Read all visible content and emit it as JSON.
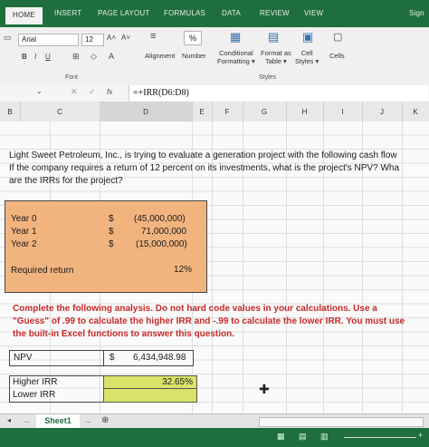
{
  "ribbon": {
    "tabs": [
      "HOME",
      "INSERT",
      "PAGE LAYOUT",
      "FORMULAS",
      "DATA",
      "REVIEW",
      "VIEW"
    ],
    "sign_in": "Sign",
    "font_name": "Arial",
    "font_size": "12",
    "font_group": "Font",
    "styles_group": "Styles",
    "alignment": "Alignment",
    "number": "Number",
    "conditional": "Conditional",
    "formatting": "Formatting",
    "format_as": "Format as",
    "table": "Table",
    "cell": "Cell",
    "styles": "Styles",
    "cells": "Cells",
    "percent_symbol": "%"
  },
  "formula_bar": {
    "fx": "fx",
    "formula": "=+IRR(D6:D8)"
  },
  "columns": [
    "B",
    "C",
    "D",
    "E",
    "F",
    "G",
    "H",
    "I",
    "J",
    "K"
  ],
  "sheet": {
    "problem_line1": "Light Sweet Petroleum, Inc., is trying to evaluate a generation project with the following cash flow",
    "problem_line2": "If the company requires a return of 12 percent on its investments, what is the project's NPV? Wha",
    "problem_line3": "are the IRRs for the project?",
    "year0_label": "Year 0",
    "year1_label": "Year 1",
    "year2_label": "Year 2",
    "year0_value": "(45,000,000)",
    "year1_value": "71,000,000",
    "year2_value": "(15,000,000)",
    "dollar": "$",
    "required_label": "Required return",
    "required_value": "12%",
    "instr_line1": "Complete the following analysis. Do not hard code values in your calculations. Use a",
    "instr_line2": "\"Guess\" of .99 to calculate the higher IRR and -.99 to calculate the lower IRR. You must use",
    "instr_line3": "the built-in Excel functions to answer this question.",
    "npv_label": "NPV",
    "npv_value": "6,434,948.98",
    "higher_label": "Higher IRR",
    "higher_value": "32.65%",
    "lower_label": "Lower IRR"
  },
  "sheet_tabs": {
    "active": "Sheet1",
    "ellipsis": "..."
  }
}
